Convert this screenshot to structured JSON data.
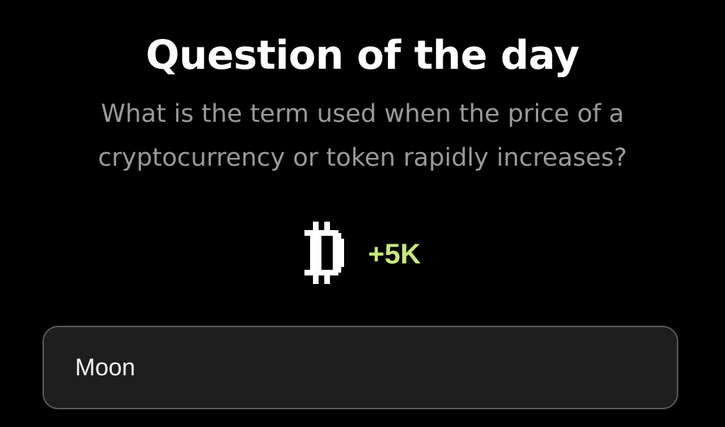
{
  "card": {
    "title": "Question of the day",
    "question": "What is the term used when the price of a cryptocurrency or token rapidly increases?",
    "reward": {
      "icon": "bitcoin-pixel-icon",
      "amount": "+5K"
    },
    "answer": {
      "value": "Moon"
    }
  },
  "colors": {
    "background": "#000000",
    "title": "#ffffff",
    "question": "#9a9a9a",
    "reward_accent": "#c8e87a",
    "answer_box": "#1e1e1e",
    "answer_border": "#5a5a5a"
  }
}
